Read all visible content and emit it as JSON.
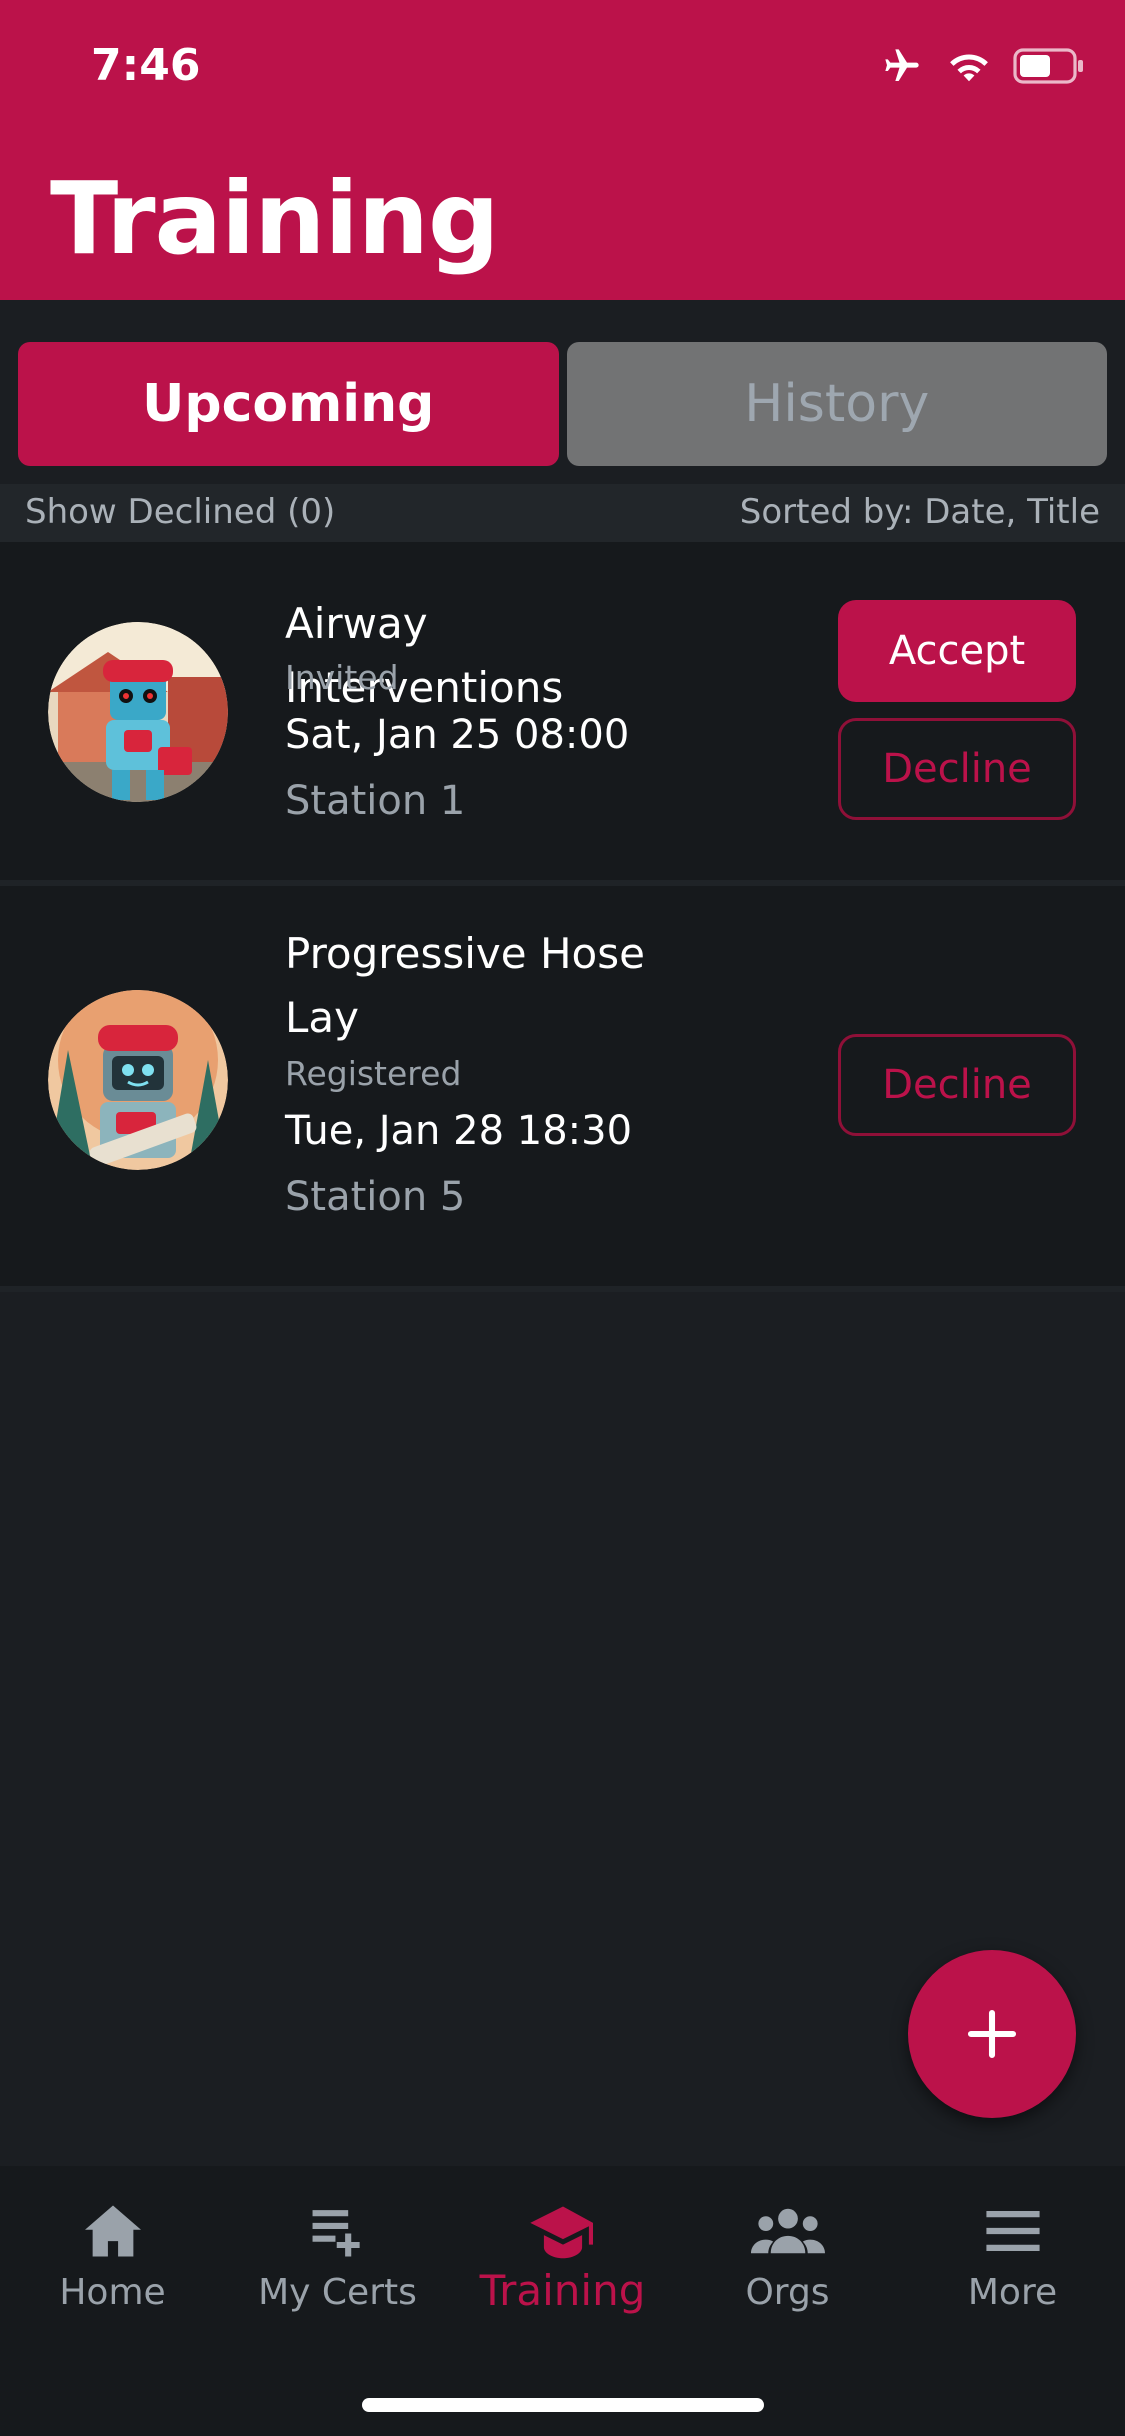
{
  "status_bar": {
    "time": "7:46"
  },
  "header": {
    "title": "Training"
  },
  "segments": [
    {
      "label": "Upcoming",
      "active": true
    },
    {
      "label": "History",
      "active": false
    }
  ],
  "filter": {
    "show_declined": "Show Declined (0)",
    "sorted_by": "Sorted by: Date, Title"
  },
  "items": [
    {
      "title": "Airway Interventions",
      "status": "Invited",
      "datetime": "Sat, Jan 25 08:00",
      "location": "Station 1",
      "actions": {
        "accept": "Accept",
        "decline": "Decline"
      }
    },
    {
      "title": "Progressive Hose Lay",
      "status": "Registered",
      "datetime": "Tue, Jan 28 18:30",
      "location": "Station 5",
      "actions": {
        "decline": "Decline"
      }
    }
  ],
  "fab": {
    "icon": "plus-icon"
  },
  "tabs": [
    {
      "label": "Home",
      "icon": "home-icon"
    },
    {
      "label": "My Certs",
      "icon": "list-add-icon"
    },
    {
      "label": "Training",
      "icon": "graduation-cap-icon",
      "active": true
    },
    {
      "label": "Orgs",
      "icon": "group-icon"
    },
    {
      "label": "More",
      "icon": "menu-icon"
    }
  ],
  "colors": {
    "accent": "#bb124a",
    "background": "#1b1e22",
    "card": "#16191c"
  }
}
